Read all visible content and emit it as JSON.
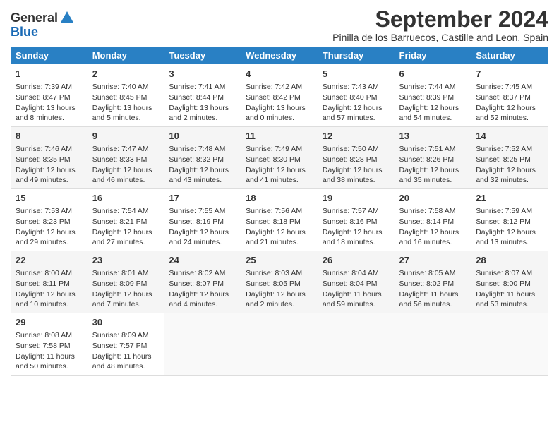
{
  "header": {
    "logo_general": "General",
    "logo_blue": "Blue",
    "month_year": "September 2024",
    "location": "Pinilla de los Barruecos, Castille and Leon, Spain"
  },
  "days_of_week": [
    "Sunday",
    "Monday",
    "Tuesday",
    "Wednesday",
    "Thursday",
    "Friday",
    "Saturday"
  ],
  "weeks": [
    [
      {
        "day": "1",
        "info": "Sunrise: 7:39 AM\nSunset: 8:47 PM\nDaylight: 13 hours and 8 minutes."
      },
      {
        "day": "2",
        "info": "Sunrise: 7:40 AM\nSunset: 8:45 PM\nDaylight: 13 hours and 5 minutes."
      },
      {
        "day": "3",
        "info": "Sunrise: 7:41 AM\nSunset: 8:44 PM\nDaylight: 13 hours and 2 minutes."
      },
      {
        "day": "4",
        "info": "Sunrise: 7:42 AM\nSunset: 8:42 PM\nDaylight: 13 hours and 0 minutes."
      },
      {
        "day": "5",
        "info": "Sunrise: 7:43 AM\nSunset: 8:40 PM\nDaylight: 12 hours and 57 minutes."
      },
      {
        "day": "6",
        "info": "Sunrise: 7:44 AM\nSunset: 8:39 PM\nDaylight: 12 hours and 54 minutes."
      },
      {
        "day": "7",
        "info": "Sunrise: 7:45 AM\nSunset: 8:37 PM\nDaylight: 12 hours and 52 minutes."
      }
    ],
    [
      {
        "day": "8",
        "info": "Sunrise: 7:46 AM\nSunset: 8:35 PM\nDaylight: 12 hours and 49 minutes."
      },
      {
        "day": "9",
        "info": "Sunrise: 7:47 AM\nSunset: 8:33 PM\nDaylight: 12 hours and 46 minutes."
      },
      {
        "day": "10",
        "info": "Sunrise: 7:48 AM\nSunset: 8:32 PM\nDaylight: 12 hours and 43 minutes."
      },
      {
        "day": "11",
        "info": "Sunrise: 7:49 AM\nSunset: 8:30 PM\nDaylight: 12 hours and 41 minutes."
      },
      {
        "day": "12",
        "info": "Sunrise: 7:50 AM\nSunset: 8:28 PM\nDaylight: 12 hours and 38 minutes."
      },
      {
        "day": "13",
        "info": "Sunrise: 7:51 AM\nSunset: 8:26 PM\nDaylight: 12 hours and 35 minutes."
      },
      {
        "day": "14",
        "info": "Sunrise: 7:52 AM\nSunset: 8:25 PM\nDaylight: 12 hours and 32 minutes."
      }
    ],
    [
      {
        "day": "15",
        "info": "Sunrise: 7:53 AM\nSunset: 8:23 PM\nDaylight: 12 hours and 29 minutes."
      },
      {
        "day": "16",
        "info": "Sunrise: 7:54 AM\nSunset: 8:21 PM\nDaylight: 12 hours and 27 minutes."
      },
      {
        "day": "17",
        "info": "Sunrise: 7:55 AM\nSunset: 8:19 PM\nDaylight: 12 hours and 24 minutes."
      },
      {
        "day": "18",
        "info": "Sunrise: 7:56 AM\nSunset: 8:18 PM\nDaylight: 12 hours and 21 minutes."
      },
      {
        "day": "19",
        "info": "Sunrise: 7:57 AM\nSunset: 8:16 PM\nDaylight: 12 hours and 18 minutes."
      },
      {
        "day": "20",
        "info": "Sunrise: 7:58 AM\nSunset: 8:14 PM\nDaylight: 12 hours and 16 minutes."
      },
      {
        "day": "21",
        "info": "Sunrise: 7:59 AM\nSunset: 8:12 PM\nDaylight: 12 hours and 13 minutes."
      }
    ],
    [
      {
        "day": "22",
        "info": "Sunrise: 8:00 AM\nSunset: 8:11 PM\nDaylight: 12 hours and 10 minutes."
      },
      {
        "day": "23",
        "info": "Sunrise: 8:01 AM\nSunset: 8:09 PM\nDaylight: 12 hours and 7 minutes."
      },
      {
        "day": "24",
        "info": "Sunrise: 8:02 AM\nSunset: 8:07 PM\nDaylight: 12 hours and 4 minutes."
      },
      {
        "day": "25",
        "info": "Sunrise: 8:03 AM\nSunset: 8:05 PM\nDaylight: 12 hours and 2 minutes."
      },
      {
        "day": "26",
        "info": "Sunrise: 8:04 AM\nSunset: 8:04 PM\nDaylight: 11 hours and 59 minutes."
      },
      {
        "day": "27",
        "info": "Sunrise: 8:05 AM\nSunset: 8:02 PM\nDaylight: 11 hours and 56 minutes."
      },
      {
        "day": "28",
        "info": "Sunrise: 8:07 AM\nSunset: 8:00 PM\nDaylight: 11 hours and 53 minutes."
      }
    ],
    [
      {
        "day": "29",
        "info": "Sunrise: 8:08 AM\nSunset: 7:58 PM\nDaylight: 11 hours and 50 minutes."
      },
      {
        "day": "30",
        "info": "Sunrise: 8:09 AM\nSunset: 7:57 PM\nDaylight: 11 hours and 48 minutes."
      },
      {
        "day": "",
        "info": ""
      },
      {
        "day": "",
        "info": ""
      },
      {
        "day": "",
        "info": ""
      },
      {
        "day": "",
        "info": ""
      },
      {
        "day": "",
        "info": ""
      }
    ]
  ]
}
